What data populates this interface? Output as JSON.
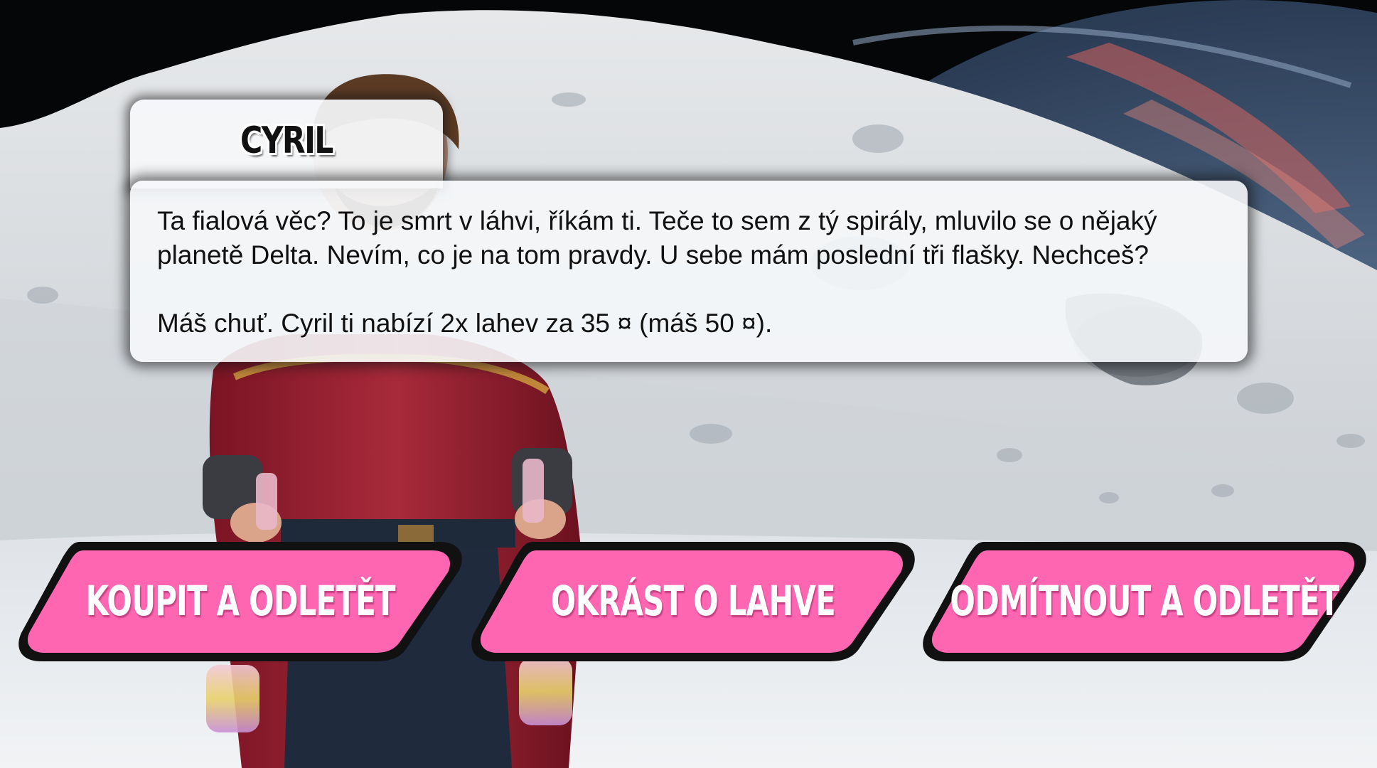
{
  "speaker": {
    "name": "CYRIL"
  },
  "dialog": {
    "line1": "Ta fialová věc? To je smrt v láhvi, říkám ti. Teče to sem z tý spirály, mluvilo se o nějaký",
    "line2": "planetě Delta. Nevím, co je na tom pravdy. U sebe mám poslední tři flašky. Nechceš?",
    "offer": "Máš chuť. Cyril ti nabízí 2x lahev za 35 ¤ (máš 50 ¤)."
  },
  "choices": [
    {
      "label": "KOUPIT A ODLETĚT"
    },
    {
      "label": "OKRÁST O LAHVE"
    },
    {
      "label": "ODMÍTNOUT A ODLETĚT"
    }
  ],
  "colors": {
    "button_fill": "#ff66b2",
    "button_border": "#111111",
    "panel": "#f5f7fa"
  }
}
